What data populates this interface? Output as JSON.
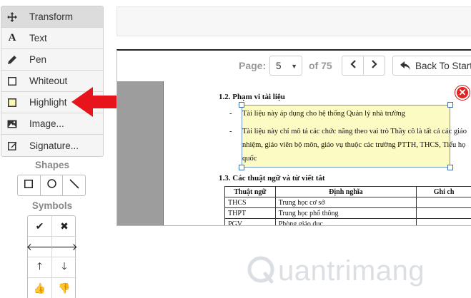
{
  "tools": [
    {
      "label": "Transform",
      "icon": "move-icon",
      "active": true
    },
    {
      "label": "Text",
      "icon": "text-icon"
    },
    {
      "label": "Pen",
      "icon": "pen-icon"
    },
    {
      "label": "Whiteout",
      "icon": "whiteout-icon"
    },
    {
      "label": "Highlight",
      "icon": "highlight-icon"
    },
    {
      "label": "Image...",
      "icon": "image-icon"
    },
    {
      "label": "Signature...",
      "icon": "signature-icon"
    }
  ],
  "shapes": {
    "title": "Shapes",
    "items": [
      "rectangle-icon",
      "circle-icon",
      "line-icon"
    ]
  },
  "symbols": {
    "title": "Symbols",
    "items": [
      "✔",
      "✖",
      "🡐",
      "🡒",
      "🡑",
      "🡓",
      "👍",
      "👎"
    ]
  },
  "pager": {
    "page_label": "Page:",
    "current_page": "5",
    "of_label": "of 75",
    "back_label": "Back To Start"
  },
  "document": {
    "heading1": "1.2.   Phạm vi tài liệu",
    "bullet1": "Tài liệu này áp dụng cho hệ thống Quản lý nhà trường",
    "bullet2_line1": "Tài liệu này chỉ mô tả các chức năng theo vai trò Thầy cô là tất cả các giáo",
    "bullet2_line2": "nhiệm, giáo viên bộ môn, giáo vụ thuộc các trường PTTH, THCS, Tiểu họ",
    "bullet2_line3": "quốc",
    "heading2": "1.3.   Các thuật ngữ và từ viết tắt",
    "dash": "-",
    "table": {
      "headers": [
        "Thuật ngữ",
        "Định nghĩa",
        "Ghi ch"
      ],
      "rows": [
        [
          "THCS",
          "Trung học cơ sở",
          ""
        ],
        [
          "THPT",
          "Trung học phổ thông",
          ""
        ],
        [
          "PGV",
          "Phòng giáo dục",
          ""
        ]
      ]
    },
    "close_symbol": "✕"
  },
  "watermark": "uantrimang",
  "colors": {
    "arrow": "#e8141b",
    "highlight": "#fdfbc4",
    "close": "#e32420"
  }
}
